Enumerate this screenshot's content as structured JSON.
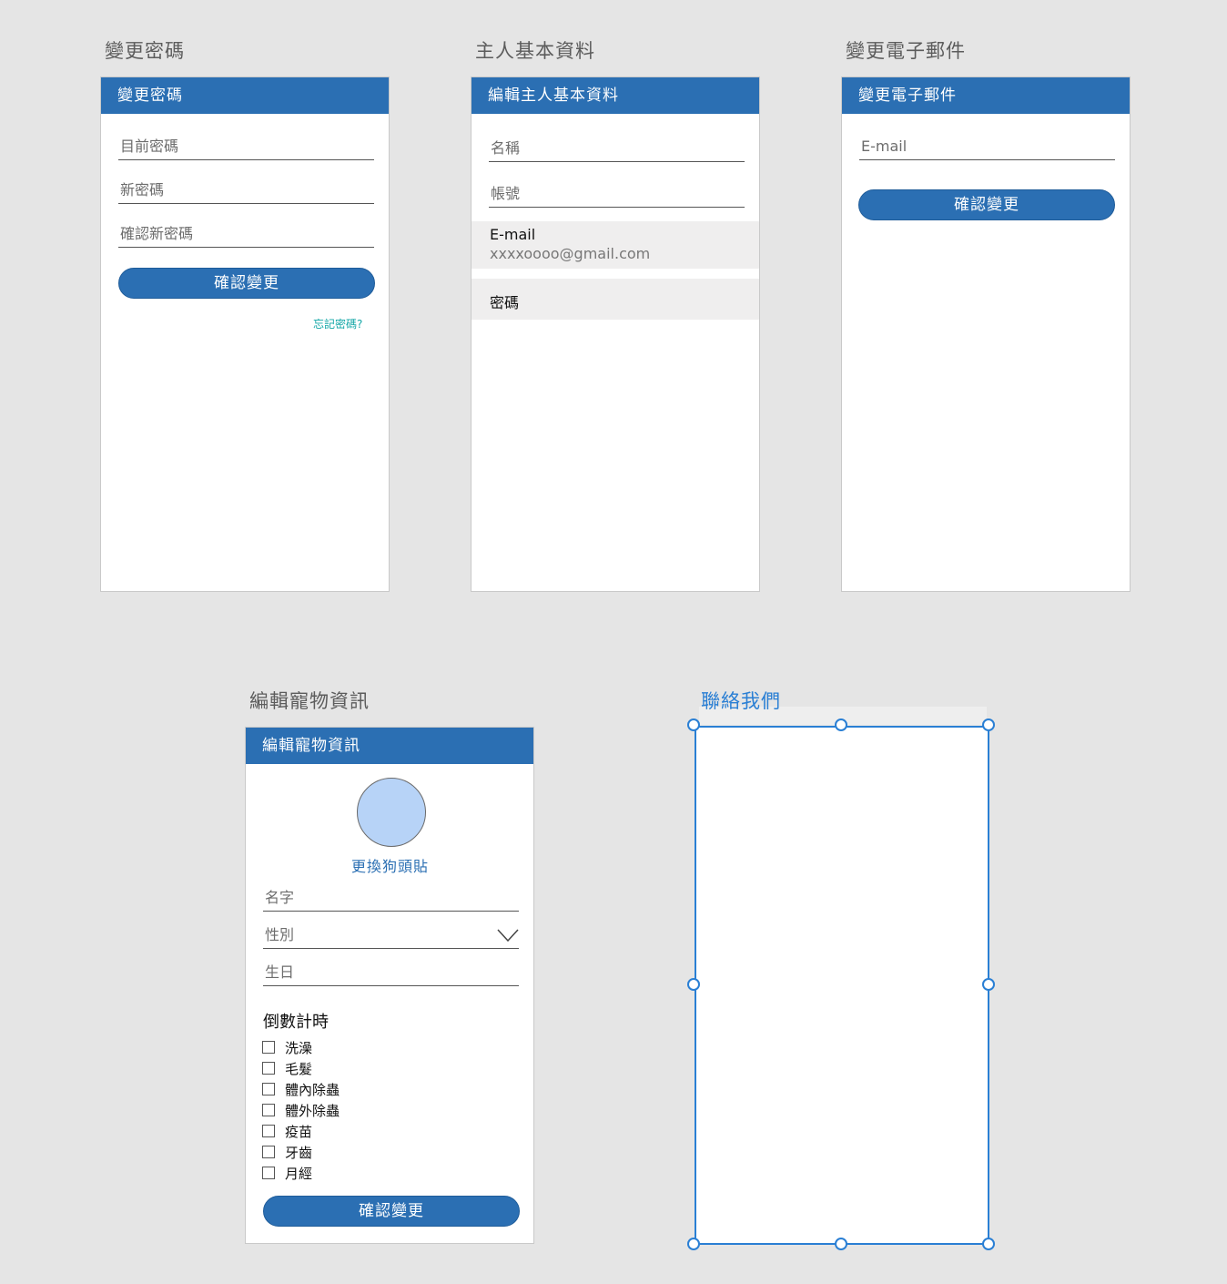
{
  "screens": {
    "change_password": {
      "title": "變更密碼",
      "header": "變更密碼",
      "fields": [
        "目前密碼",
        "新密碼",
        "確認新密碼"
      ],
      "button": "確認變更",
      "forgot": "忘記密碼?"
    },
    "owner_profile": {
      "title": "主人基本資料",
      "header": "編輯主人基本資料",
      "fields": [
        "名稱",
        "帳號"
      ],
      "email_label": "E-mail",
      "email_value": "xxxxoooo@gmail.com",
      "password_label": "密碼"
    },
    "change_email": {
      "title": "變更電子郵件",
      "header": "變更電子郵件",
      "field": "E-mail",
      "button": "確認變更"
    },
    "edit_pet": {
      "title": "編輯寵物資訊",
      "header": "編輯寵物資訊",
      "avatar_link": "更換狗頭貼",
      "fields": [
        "名字",
        "性別",
        "生日"
      ],
      "countdown_title": "倒數計時",
      "checkboxes": [
        "洗澡",
        "毛髮",
        "體內除蟲",
        "體外除蟲",
        "疫苗",
        "牙齒",
        "月經"
      ],
      "button": "確認變更"
    },
    "contact_us": {
      "title": "聯絡我們"
    }
  },
  "colors": {
    "header_blue": "#2b6fb3",
    "selection_blue": "#2a7fd4",
    "link_teal": "#14a7a7",
    "avatar_fill": "#b7d3f7",
    "background": "#e5e5e5"
  },
  "icons": {
    "gender_dropdown": "chevron-down-icon",
    "selection_handles": "resize-handle-icon"
  }
}
